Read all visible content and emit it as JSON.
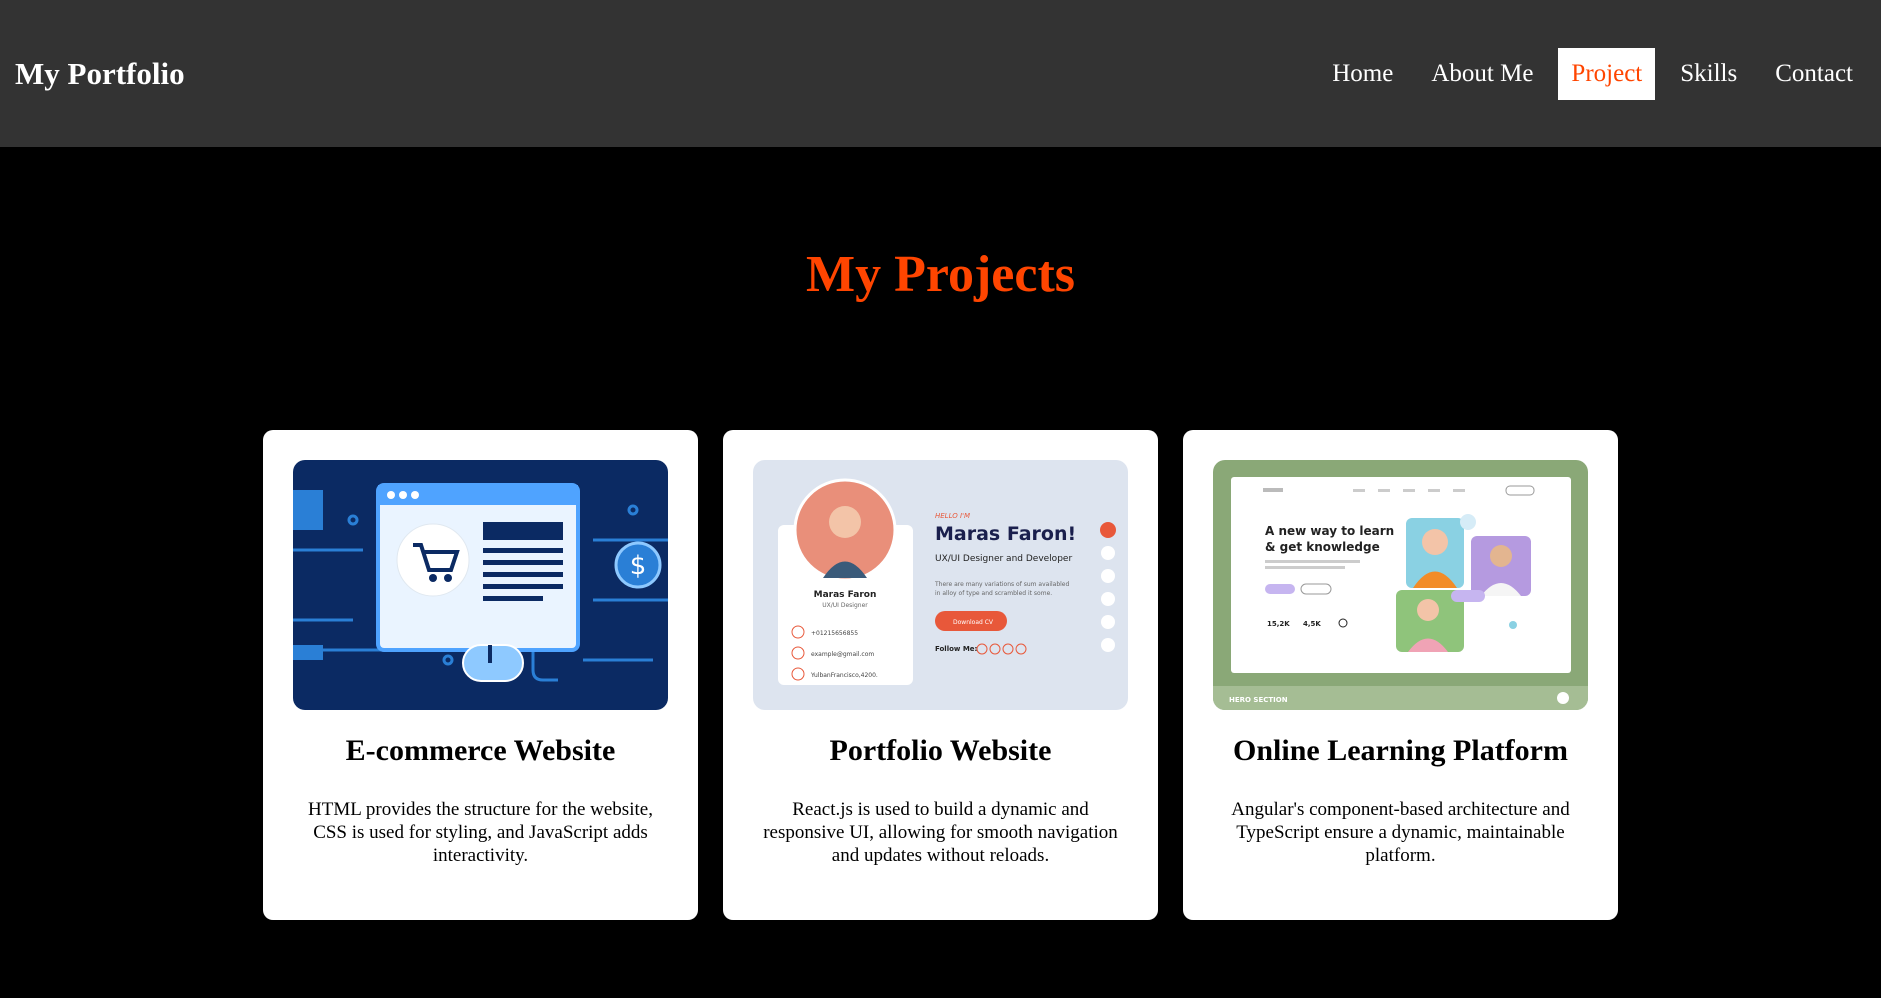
{
  "header": {
    "brand": "My Portfolio",
    "nav": [
      "Home",
      "About Me",
      "Project",
      "Skills",
      "Contact"
    ],
    "active_nav": "Project"
  },
  "main": {
    "title": "My Projects",
    "projects": [
      {
        "title": "E-commerce Website",
        "description": "HTML provides the structure for the website, CSS is used for styling, and JavaScript adds interactivity.",
        "image": "ecommerce-illustration"
      },
      {
        "title": "Portfolio Website",
        "description": "React.js is used to build a dynamic and responsive UI, allowing for smooth navigation and updates without reloads.",
        "image": "portfolio-mockup",
        "mockup": {
          "hello": "HELLO I'M",
          "name": "Maras Faron!",
          "role": "UX/UI Designer and Developer",
          "blurb1": "There are many variations of sum availabled",
          "blurb2": "in alloy of type and scrambled it some.",
          "button": "Download CV",
          "follow": "Follow Me:",
          "card_name": "Maras Faron",
          "card_role": "UX/UI Designer",
          "phone": "+01215656855",
          "email": "example@gmail.com",
          "address": "YulbanFrancisco,4200."
        }
      },
      {
        "title": "Online Learning Platform",
        "description": "Angular's component-based architecture and TypeScript ensure a dynamic, maintainable platform.",
        "image": "learning-mockup",
        "mockup": {
          "headline1": "A new way to learn",
          "headline2": "& get knowledge",
          "stat1": "15,2K",
          "stat2": "4,5K",
          "caption": "HERO SECTION"
        }
      }
    ]
  },
  "colors": {
    "accent": "#ff4500",
    "navbar": "#333333",
    "page_bg": "#000000"
  }
}
